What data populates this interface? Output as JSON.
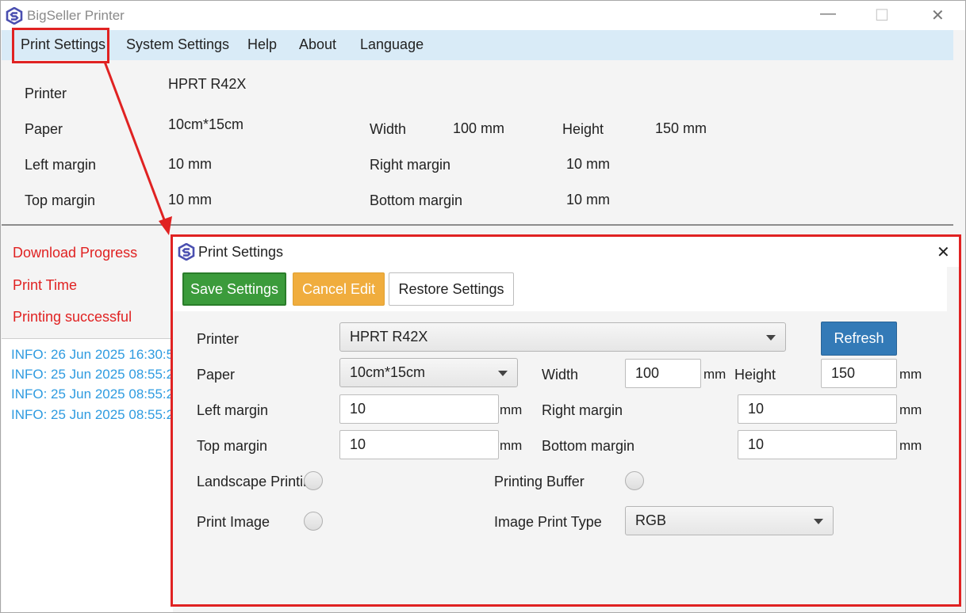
{
  "window": {
    "title": "BigSeller Printer",
    "controls": {
      "minimize": "—",
      "maximize": "☐",
      "close": "✕"
    }
  },
  "menu": {
    "items": [
      "Print Settings",
      "System Settings",
      "Help",
      "About",
      "Language"
    ]
  },
  "summary": {
    "printer_label": "Printer",
    "printer_value": "HPRT R42X",
    "paper_label": "Paper",
    "paper_value": "10cm*15cm",
    "width_label": "Width",
    "width_value": "100 mm",
    "height_label": "Height",
    "height_value": "150 mm",
    "left_margin_label": "Left margin",
    "left_margin_value": "10 mm",
    "right_margin_label": "Right margin",
    "right_margin_value": "10 mm",
    "top_margin_label": "Top margin",
    "top_margin_value": "10 mm",
    "bottom_margin_label": "Bottom margin",
    "bottom_margin_value": "10 mm"
  },
  "status": {
    "download_progress": "Download Progress",
    "print_time": "Print Time",
    "printing_result": "Printing successful"
  },
  "log": [
    "INFO: 26 Jun 2025 16:30:5",
    "INFO: 25 Jun 2025 08:55:2",
    "INFO: 25 Jun 2025 08:55:2",
    "INFO: 25 Jun 2025 08:55:2"
  ],
  "dialog": {
    "title": "Print Settings",
    "close": "✕",
    "toolbar": {
      "save": "Save Settings",
      "cancel": "Cancel Edit",
      "restore": "Restore Settings"
    },
    "printer_label": "Printer",
    "printer_selected": "HPRT R42X",
    "refresh": "Refresh",
    "paper_label": "Paper",
    "paper_selected": "10cm*15cm",
    "width_label": "Width",
    "width_value": "100",
    "height_label": "Height",
    "height_value": "150",
    "left_margin_label": "Left margin",
    "left_margin_value": "10",
    "right_margin_label": "Right margin",
    "right_margin_value": "10",
    "top_margin_label": "Top margin",
    "top_margin_value": "10",
    "bottom_margin_label": "Bottom margin",
    "bottom_margin_value": "10",
    "unit": "mm",
    "landscape_label": "Landscape Printin",
    "buffer_label": "Printing Buffer",
    "print_image_label": "Print Image",
    "image_type_label": "Image Print Type",
    "image_type_selected": "RGB"
  },
  "colors": {
    "menubar": "#d9ebf7",
    "highlight": "#e02222",
    "save": "#3b9b3b",
    "cancel": "#f0ad3e",
    "refresh": "#337ab7",
    "log_text": "#2e9be0"
  }
}
